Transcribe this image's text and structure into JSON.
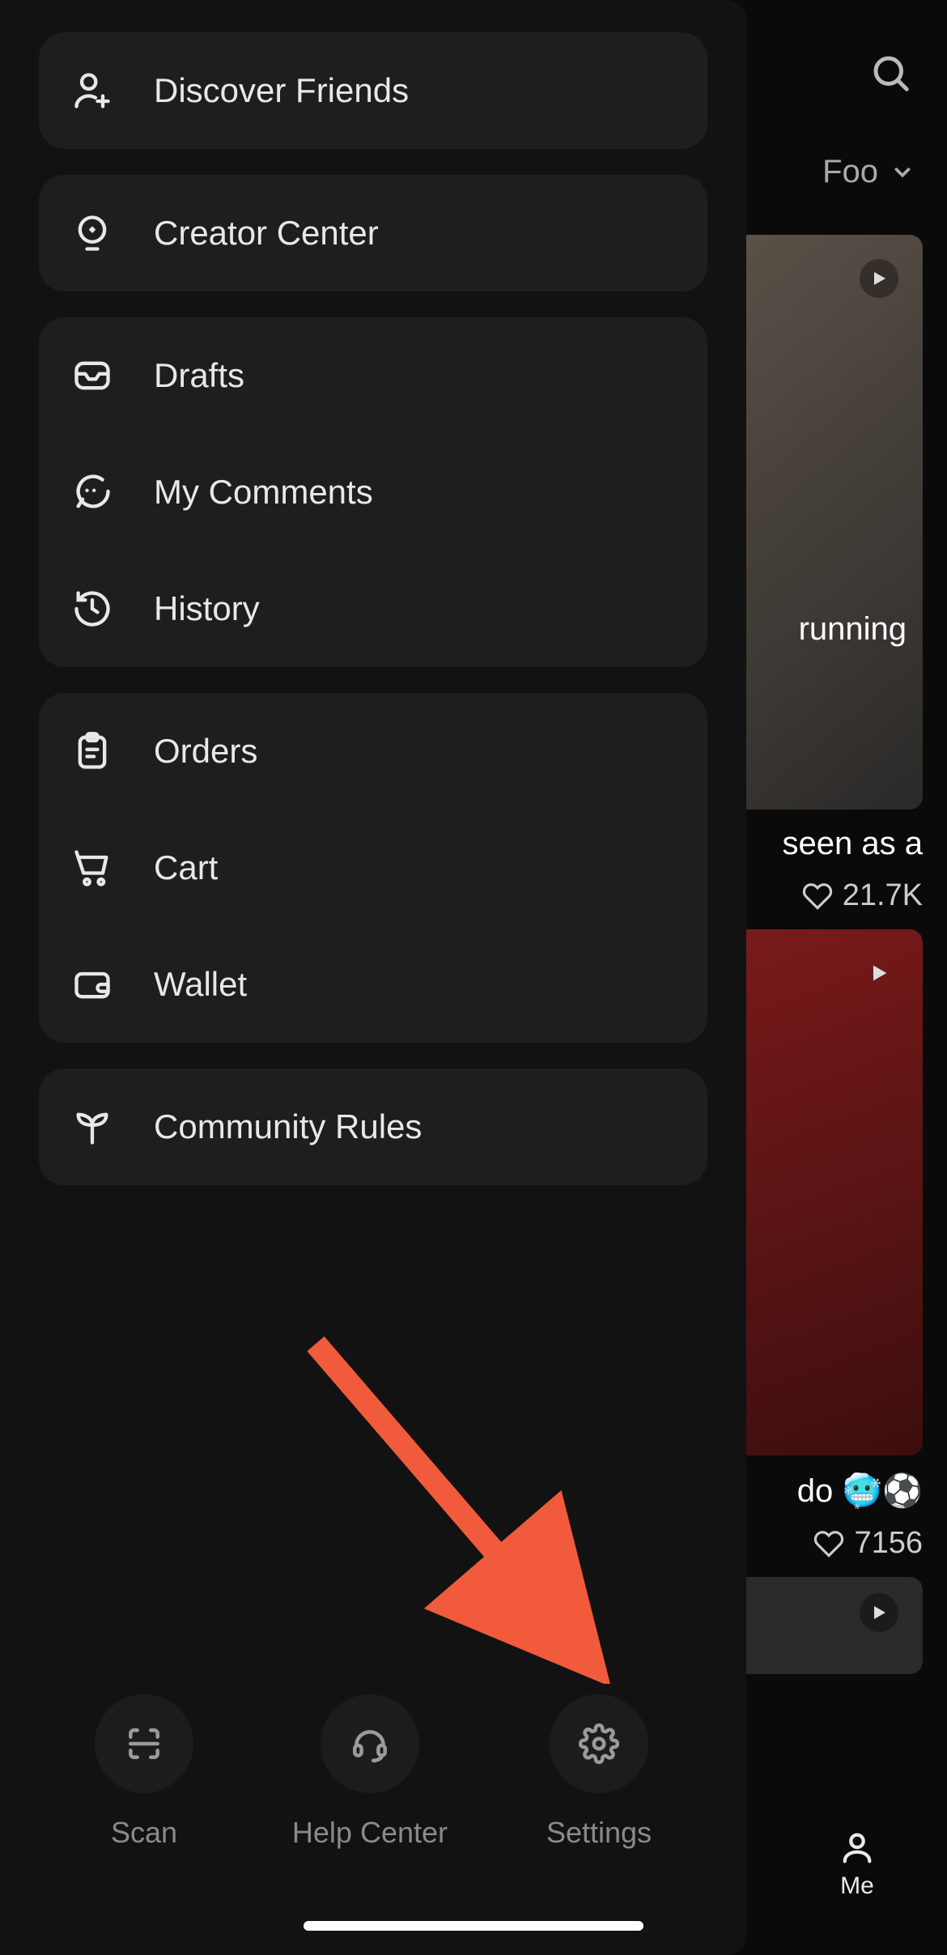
{
  "drawer": {
    "groups": [
      {
        "items": [
          {
            "key": "discover-friends",
            "label": "Discover Friends",
            "icon": "user-plus-icon"
          }
        ]
      },
      {
        "items": [
          {
            "key": "creator-center",
            "label": "Creator Center",
            "icon": "bulb-icon"
          }
        ]
      },
      {
        "items": [
          {
            "key": "drafts",
            "label": "Drafts",
            "icon": "inbox-icon"
          },
          {
            "key": "my-comments",
            "label": "My Comments",
            "icon": "comment-icon"
          },
          {
            "key": "history",
            "label": "History",
            "icon": "history-icon"
          }
        ]
      },
      {
        "items": [
          {
            "key": "orders",
            "label": "Orders",
            "icon": "clipboard-icon"
          },
          {
            "key": "cart",
            "label": "Cart",
            "icon": "cart-icon"
          },
          {
            "key": "wallet",
            "label": "Wallet",
            "icon": "wallet-icon"
          }
        ]
      },
      {
        "items": [
          {
            "key": "community-rules",
            "label": "Community Rules",
            "icon": "sprout-icon"
          }
        ]
      }
    ],
    "bottom": [
      {
        "key": "scan",
        "label": "Scan",
        "icon": "scan-icon"
      },
      {
        "key": "help-center",
        "label": "Help Center",
        "icon": "headset-icon"
      },
      {
        "key": "settings",
        "label": "Settings",
        "icon": "gear-icon"
      }
    ]
  },
  "background": {
    "tab_partial": "Foo",
    "card1_caption_partial1": "running",
    "card1_caption_partial2": "seen as a",
    "card1_likes": "21.7K",
    "card2_caption_partial": "do 🥶⚽",
    "card2_likes": "7156",
    "nav_me": "Me"
  },
  "annotation": {
    "arrow_color": "#f15a3b"
  }
}
